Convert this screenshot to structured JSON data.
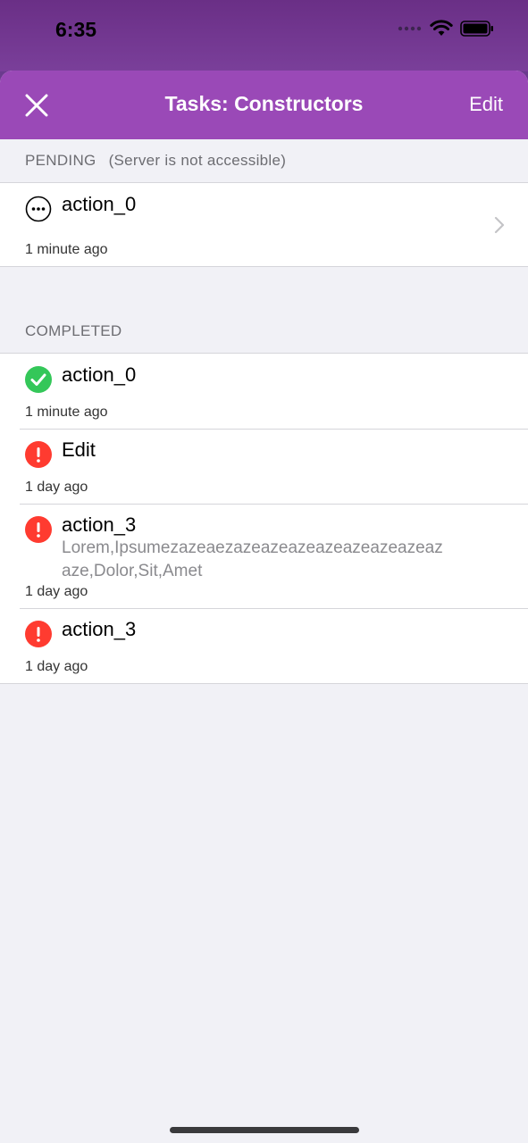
{
  "status": {
    "time": "6:35"
  },
  "nav": {
    "title": "Tasks: Constructors",
    "edit_label": "Edit"
  },
  "pending": {
    "header": "PENDING",
    "note": "(Server is not accessible)",
    "items": [
      {
        "title": "action_0",
        "time": "1 minute ago",
        "status": "pending"
      }
    ]
  },
  "completed": {
    "header": "COMPLETED",
    "items": [
      {
        "title": "action_0",
        "time": "1 minute ago",
        "status": "success"
      },
      {
        "title": "Edit",
        "time": "1 day ago",
        "status": "error"
      },
      {
        "title": "action_3",
        "subtitle": "Lorem,Ipsumezazeaezazeazeazeazeazeazeazeaz aze,Dolor,Sit,Amet",
        "time": "1 day ago",
        "status": "error"
      },
      {
        "title": "action_3",
        "time": "1 day ago",
        "status": "error"
      }
    ]
  },
  "colors": {
    "accent": "#9a49b7",
    "success": "#34c759",
    "error": "#ff3b30"
  }
}
